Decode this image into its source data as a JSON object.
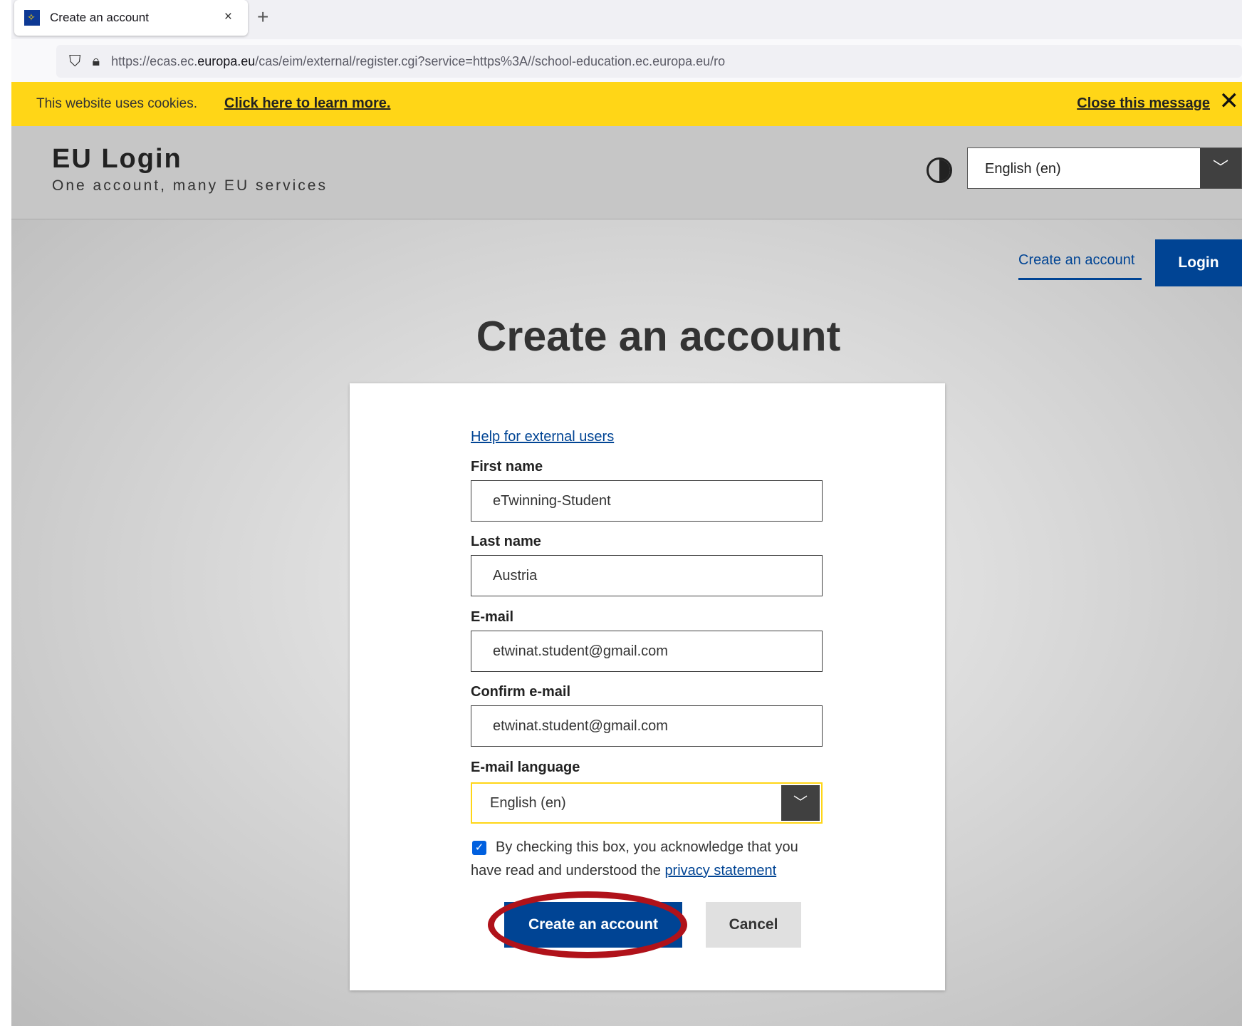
{
  "browser": {
    "tab_title": "Create an account",
    "tab_close": "×",
    "new_tab": "+",
    "url_prefix": "https://ecas.ec.",
    "url_domain": "europa.eu",
    "url_rest": "/cas/eim/external/register.cgi?service=https%3A//school-education.ec.europa.eu/ro"
  },
  "cookie_banner": {
    "message": "This website uses cookies.",
    "learn_more": "Click here to learn more.",
    "close_label": "Close this message"
  },
  "header": {
    "brand": "EU Login",
    "tagline": "One account, many EU services",
    "language_selected": "English (en)"
  },
  "nav": {
    "create_account_link": "Create an account",
    "login_button": "Login"
  },
  "page_title": "Create an account",
  "form": {
    "help_link": "Help for external users",
    "first_name_label": "First name",
    "first_name_value": "eTwinning-Student",
    "last_name_label": "Last name",
    "last_name_value": "Austria",
    "email_label": "E-mail",
    "email_value": "etwinat.student@gmail.com",
    "confirm_email_label": "Confirm e-mail",
    "confirm_email_value": "etwinat.student@gmail.com",
    "email_language_label": "E-mail language",
    "email_language_value": "English (en)",
    "consent_checked": true,
    "consent_line1": "By checking this box, you acknowledge that you",
    "consent_line2": "have read and understood the ",
    "privacy_link": "privacy statement",
    "submit_label": "Create an account",
    "cancel_label": "Cancel"
  },
  "colors": {
    "brand_blue": "#004494",
    "cookie_yellow": "#ffd617",
    "highlight_ring": "#b0121a"
  }
}
